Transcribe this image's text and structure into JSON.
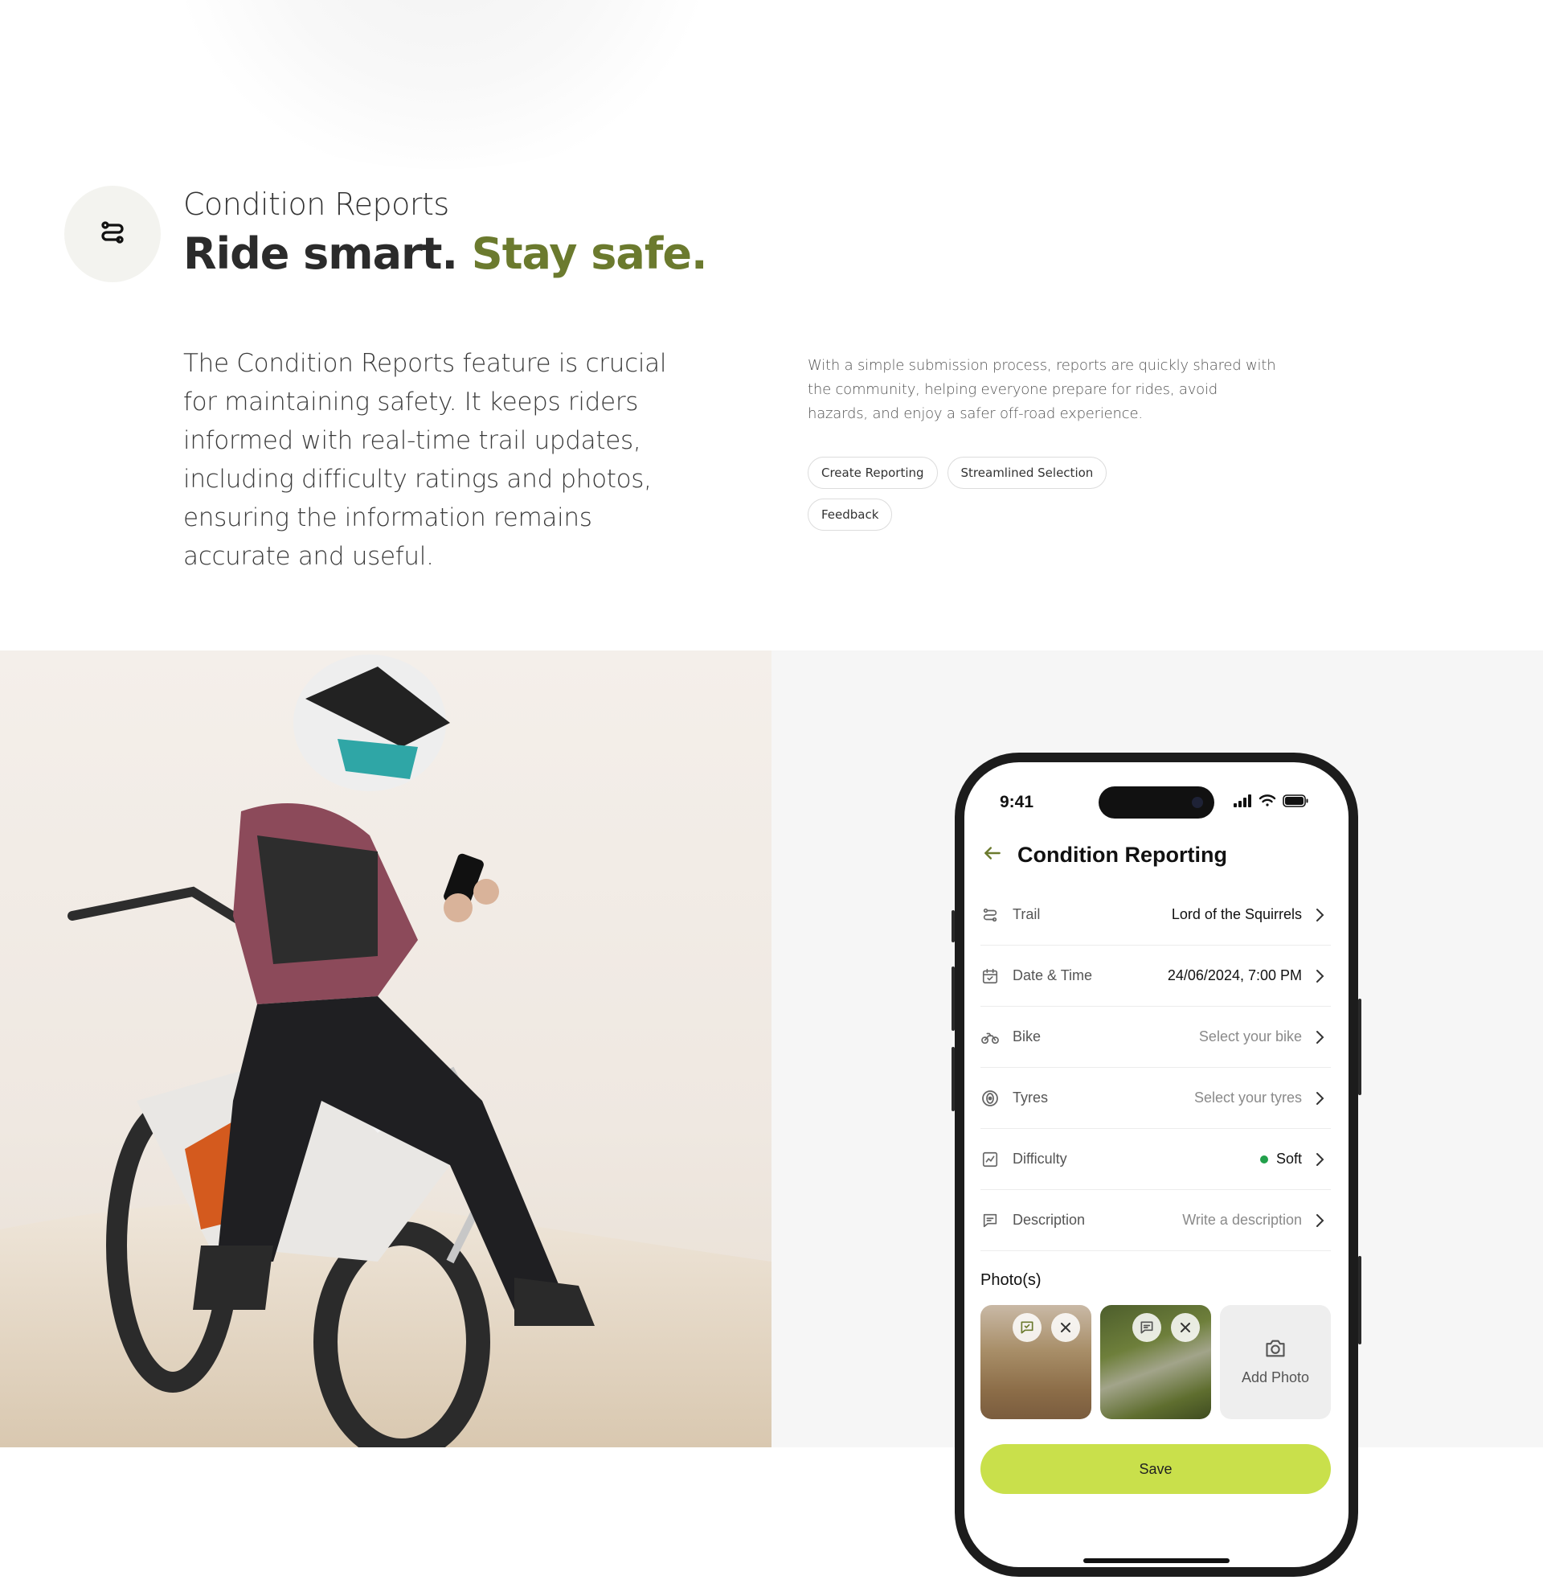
{
  "section": {
    "eyebrow": "Condition Reports",
    "headline_main": "Ride smart.",
    "headline_accent": "Stay safe.",
    "lead": "The Condition Reports feature is crucial for maintaining safety. It keeps riders informed with real-time trail updates, including difficulty ratings and photos, ensuring the information remains accurate and useful.",
    "side_copy": "With a simple submission process, reports are quickly shared with the community, helping everyone prepare for rides, avoid hazards, and enjoy a safer off-road experience.",
    "chips": [
      "Create Reporting",
      "Streamlined Selection",
      "Feedback"
    ],
    "badge_icon": "route-icon"
  },
  "phone": {
    "time": "9:41",
    "title": "Condition Reporting",
    "rows": [
      {
        "icon": "route-icon",
        "label": "Trail",
        "value": "Lord of the Squirrels",
        "placeholder": false
      },
      {
        "icon": "calendar-check-icon",
        "label": "Date & Time",
        "value": "24/06/2024, 7:00 PM",
        "placeholder": false
      },
      {
        "icon": "bike-icon",
        "label": "Bike",
        "value": "Select your bike",
        "placeholder": true
      },
      {
        "icon": "tyre-icon",
        "label": "Tyres",
        "value": "Select your tyres",
        "placeholder": true
      },
      {
        "icon": "chart-icon",
        "label": "Difficulty",
        "value": "Soft",
        "placeholder": false
      },
      {
        "icon": "message-icon",
        "label": "Description",
        "value": "Write a description",
        "placeholder": true
      }
    ],
    "photos_title": "Photo(s)",
    "add_photo_label": "Add Photo",
    "save_label": "Save"
  },
  "colors": {
    "accent_olive": "#6b7a2e",
    "save_lime": "#c9e04b",
    "difficulty_green": "#22a04b",
    "badge_bg": "#f3f3ef"
  }
}
